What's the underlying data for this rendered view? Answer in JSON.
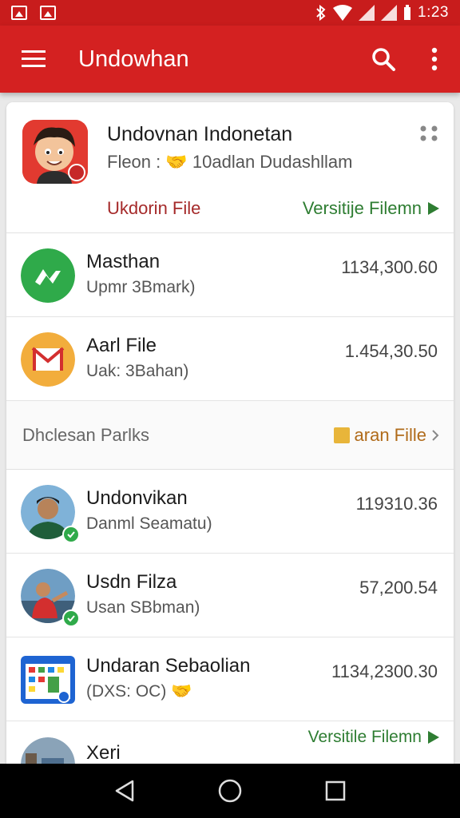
{
  "status_bar": {
    "time": "1:23",
    "icons": [
      "image-icon",
      "gallery-icon",
      "bluetooth-icon",
      "wifi-icon",
      "signal-icon",
      "signal-icon",
      "battery-icon"
    ]
  },
  "app_bar": {
    "title": "Undowhan",
    "color": "#d42121",
    "icons": [
      "menu-icon",
      "search-icon",
      "more-vert-icon"
    ]
  },
  "header_card": {
    "title": "Undovnan Indonetan",
    "subtitle": "Fleon : 🤝 10adlan Dudashllam",
    "left_link": "Ukdorin File",
    "right_link": "Versitije Filemn"
  },
  "rows_top": [
    {
      "name": "Masthan",
      "sub": "Upmr 3Bmark)",
      "amount": "1134,300.60",
      "icon": "green-logo-icon"
    },
    {
      "name": "Aarl File",
      "sub": "Uak: 3Bahan)",
      "amount": "1.454,30.50",
      "icon": "mail-icon"
    }
  ],
  "section": {
    "title": "Dhclesan Parlks",
    "link": "aran Fille"
  },
  "rows_bottom": [
    {
      "name": "Undonvikan",
      "sub": "Danml Seamatu)",
      "amount": "119310.36",
      "icon": "person-avatar-icon"
    },
    {
      "name": "Usdn Filza",
      "sub": "Usan SBbman)",
      "amount": "57,200.54",
      "icon": "person-avatar-icon"
    },
    {
      "name": "Undaran Sebaolian",
      "sub": "(DXS: OC) 🤝",
      "amount": "1134,2300.30",
      "icon": "calendar-app-icon"
    }
  ],
  "row_partial": {
    "name": "Xeri",
    "link": "Versitile Filemn"
  },
  "nav_bar": {
    "icons": [
      "back-icon",
      "home-icon",
      "recents-icon"
    ]
  }
}
